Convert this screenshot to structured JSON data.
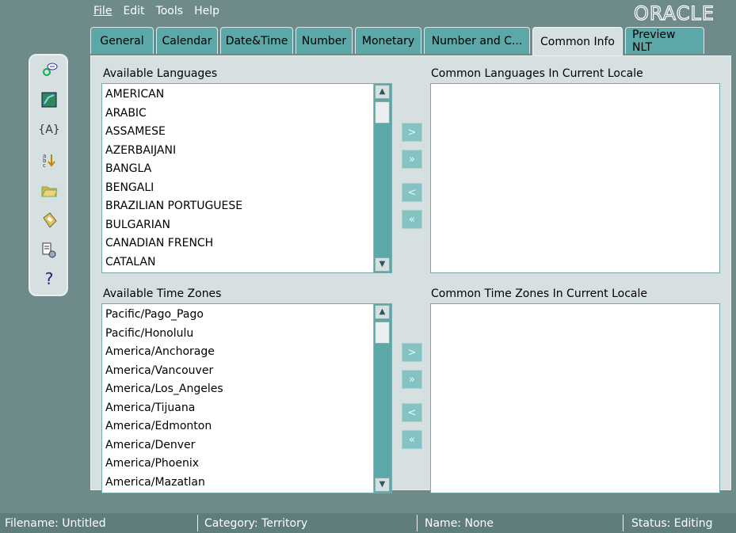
{
  "menu": {
    "file": "File",
    "edit": "Edit",
    "tools": "Tools",
    "help": "Help"
  },
  "brand": "ORACLE",
  "tabs": [
    "General",
    "Calendar",
    "Date&Time",
    "Number",
    "Monetary",
    "Number and C...",
    "Common Info",
    "Preview NLT"
  ],
  "active_tab": "Common Info",
  "languages": {
    "available_label": "Available Languages",
    "available": [
      "AMERICAN",
      "ARABIC",
      "ASSAMESE",
      "AZERBAIJANI",
      "BANGLA",
      "BENGALI",
      "BRAZILIAN PORTUGUESE",
      "BULGARIAN",
      "CANADIAN FRENCH",
      "CATALAN"
    ],
    "common_label": "Common Languages In Current Locale"
  },
  "timezones": {
    "available_label": "Available Time Zones",
    "available": [
      "Pacific/Pago_Pago",
      "Pacific/Honolulu",
      "America/Anchorage",
      "America/Vancouver",
      "America/Los_Angeles",
      "America/Tijuana",
      "America/Edmonton",
      "America/Denver",
      "America/Phoenix",
      "America/Mazatlan"
    ],
    "common_label": "Common Time Zones In Current Locale"
  },
  "shuttle": {
    "move_one": ">",
    "move_all": "»",
    "remove_one": "<",
    "remove_all": "«"
  },
  "status": {
    "filename": "Filename: Untitled",
    "category": "Category: Territory",
    "name": "Name: None",
    "state": "Status: Editing"
  },
  "colors": {
    "background": "#6e8a8a",
    "panel": "#d6e0e0",
    "tab": "#5ca8a8",
    "scrollbar": "#5ca8a8"
  }
}
